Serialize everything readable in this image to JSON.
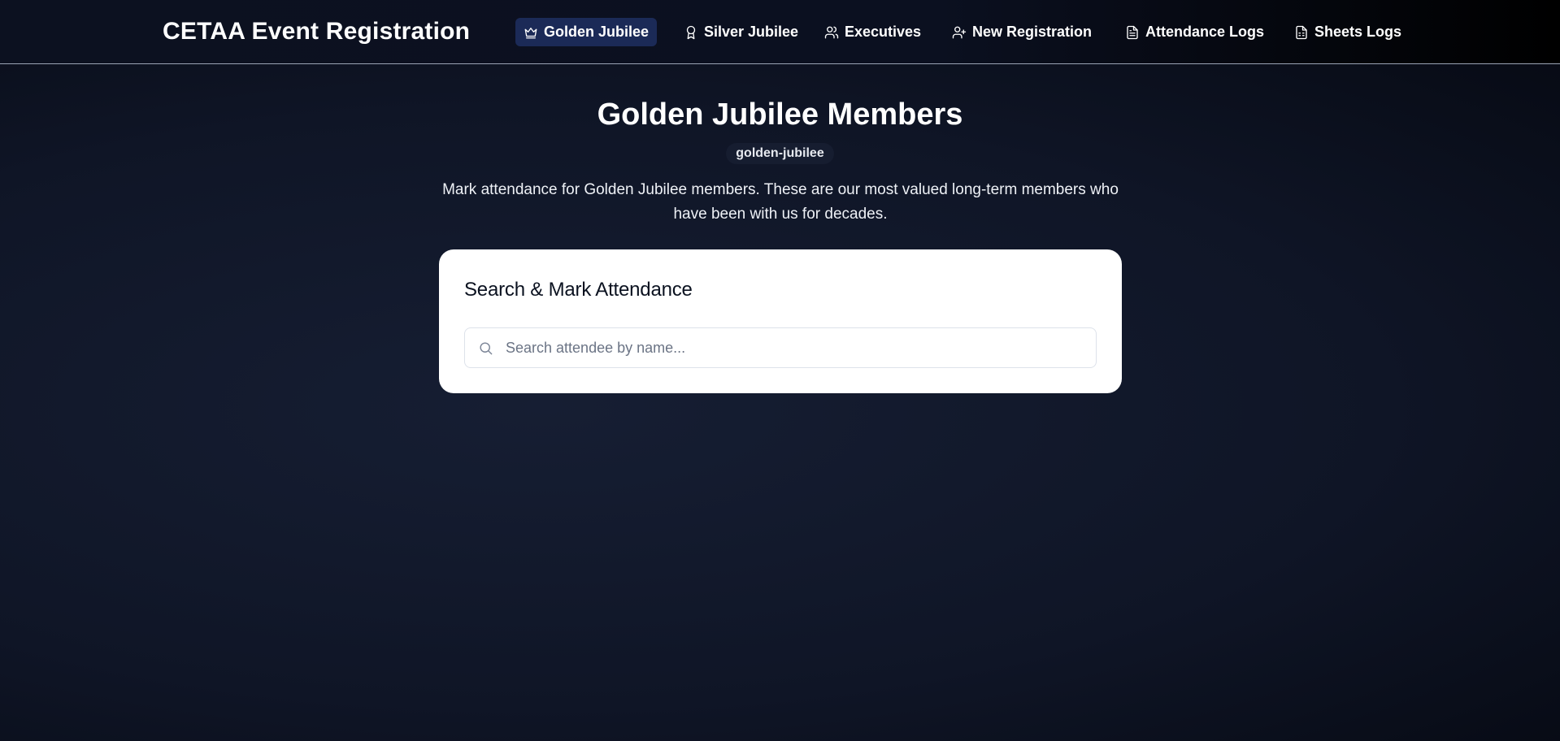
{
  "header": {
    "brand": "CETAA Event Registration",
    "nav": [
      {
        "label": "Golden Jubilee",
        "icon": "crown-icon",
        "active": true
      },
      {
        "label": "Silver Jubilee",
        "icon": "award-icon",
        "active": false
      },
      {
        "label": "Executives",
        "icon": "users-icon",
        "active": false
      },
      {
        "label": "New Registration",
        "icon": "user-plus-icon",
        "active": false
      },
      {
        "label": "Attendance Logs",
        "icon": "file-text-icon",
        "active": false
      },
      {
        "label": "Sheets Logs",
        "icon": "file-spreadsheet-icon",
        "active": false
      }
    ]
  },
  "main": {
    "title": "Golden Jubilee Members",
    "badge": "golden-jubilee",
    "description": "Mark attendance for Golden Jubilee members. These are our most valued long-term members who have been with us for decades.",
    "card": {
      "title": "Search & Mark Attendance",
      "search_placeholder": "Search attendee by name...",
      "search_value": ""
    }
  },
  "colors": {
    "background": "#0f1526",
    "active_nav": "#1b2a57",
    "card": "#ffffff"
  }
}
